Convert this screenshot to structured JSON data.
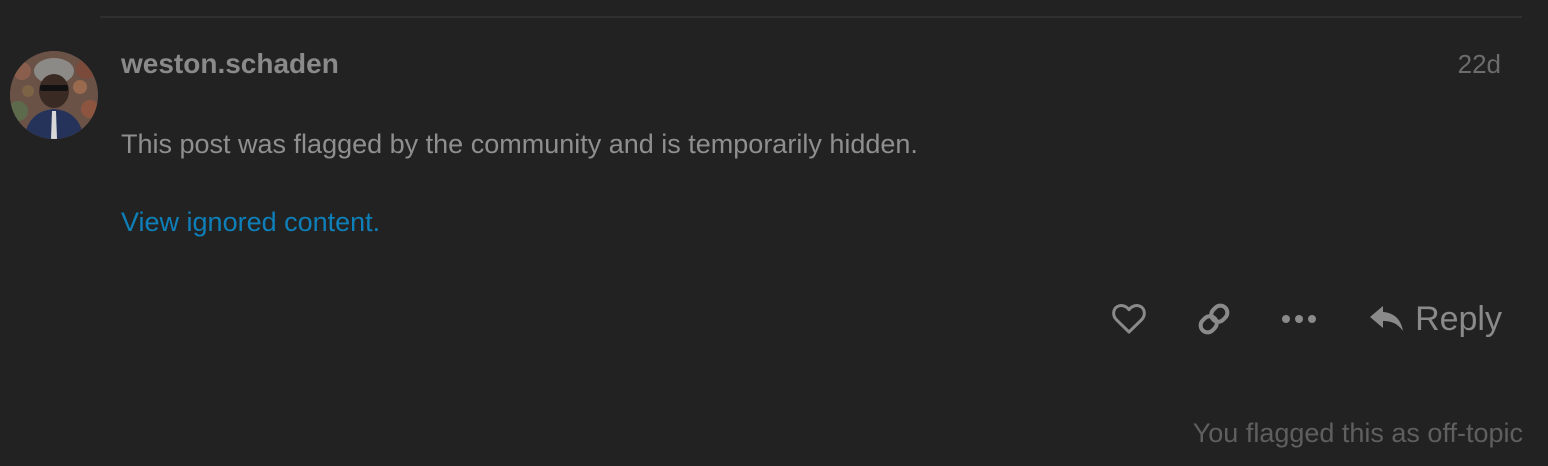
{
  "post": {
    "username": "weston.schaden",
    "date": "22d",
    "hidden_notice": "This post was flagged by the community and is temporarily hidden.",
    "view_ignored_link": "View ignored content.",
    "flag_status": "You flagged this as off-topic"
  },
  "actions": {
    "like_icon": "heart-icon",
    "link_icon": "link-icon",
    "more_icon": "ellipsis-icon",
    "reply_icon": "reply-arrow-icon",
    "reply_label": "Reply"
  },
  "colors": {
    "background": "#222222",
    "username": "#8a8a8a",
    "body_text": "#8f8f8f",
    "link": "#0e7fb8",
    "muted": "#5f5f5f"
  }
}
